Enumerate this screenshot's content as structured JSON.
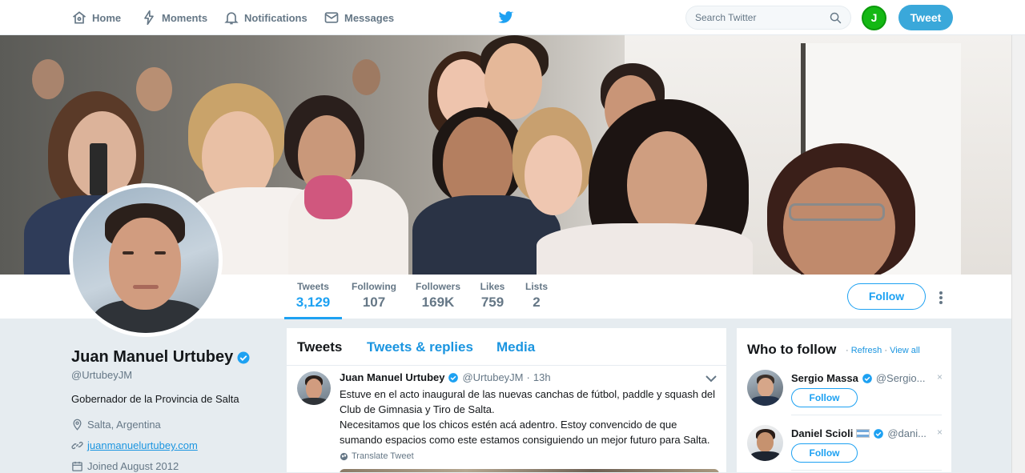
{
  "nav": {
    "home": "Home",
    "moments": "Moments",
    "notifications": "Notifications",
    "messages": "Messages",
    "search_placeholder": "Search Twitter",
    "tweet_button": "Tweet",
    "account_avatar_letter": "J"
  },
  "profile": {
    "name": "Juan Manuel Urtubey",
    "handle": "@UrtubeyJM",
    "bio": "Gobernador de la Provincia de Salta",
    "location": "Salta, Argentina",
    "website": "juanmanuelurtubey.com",
    "joined": "Joined August 2012"
  },
  "stats": [
    {
      "label": "Tweets",
      "value": "3,129"
    },
    {
      "label": "Following",
      "value": "107"
    },
    {
      "label": "Followers",
      "value": "169K"
    },
    {
      "label": "Likes",
      "value": "759"
    },
    {
      "label": "Lists",
      "value": "2"
    }
  ],
  "follow_button": "Follow",
  "timeline": {
    "tabs": [
      "Tweets",
      "Tweets & replies",
      "Media"
    ],
    "tweet": {
      "name": "Juan Manuel Urtubey",
      "handle": "@UrtubeyJM",
      "separator": "·",
      "time": "13h",
      "text_line1": "Estuve en el acto inaugural de las nuevas canchas de fútbol, paddle y squash del Club de Gimnasia y Tiro de Salta.",
      "text_line2": "Necesitamos que los chicos estén acá adentro. Estoy convencido de que sumando espacios como este estamos consiguiendo un mejor futuro para Salta.",
      "translate": "Translate Tweet"
    }
  },
  "who_to_follow": {
    "title": "Who to follow",
    "sep": "·",
    "refresh": "Refresh",
    "view_all": "View all",
    "users": [
      {
        "name": "Sergio Massa",
        "handle": "@Sergio...",
        "follow": "Follow",
        "dismiss": "×"
      },
      {
        "name": "Daniel Scioli",
        "handle": "@dani...",
        "follow": "Follow",
        "dismiss": "×"
      }
    ]
  },
  "colors": {
    "accent": "#1da1f2",
    "link": "#1b95e0",
    "muted": "#657786"
  }
}
